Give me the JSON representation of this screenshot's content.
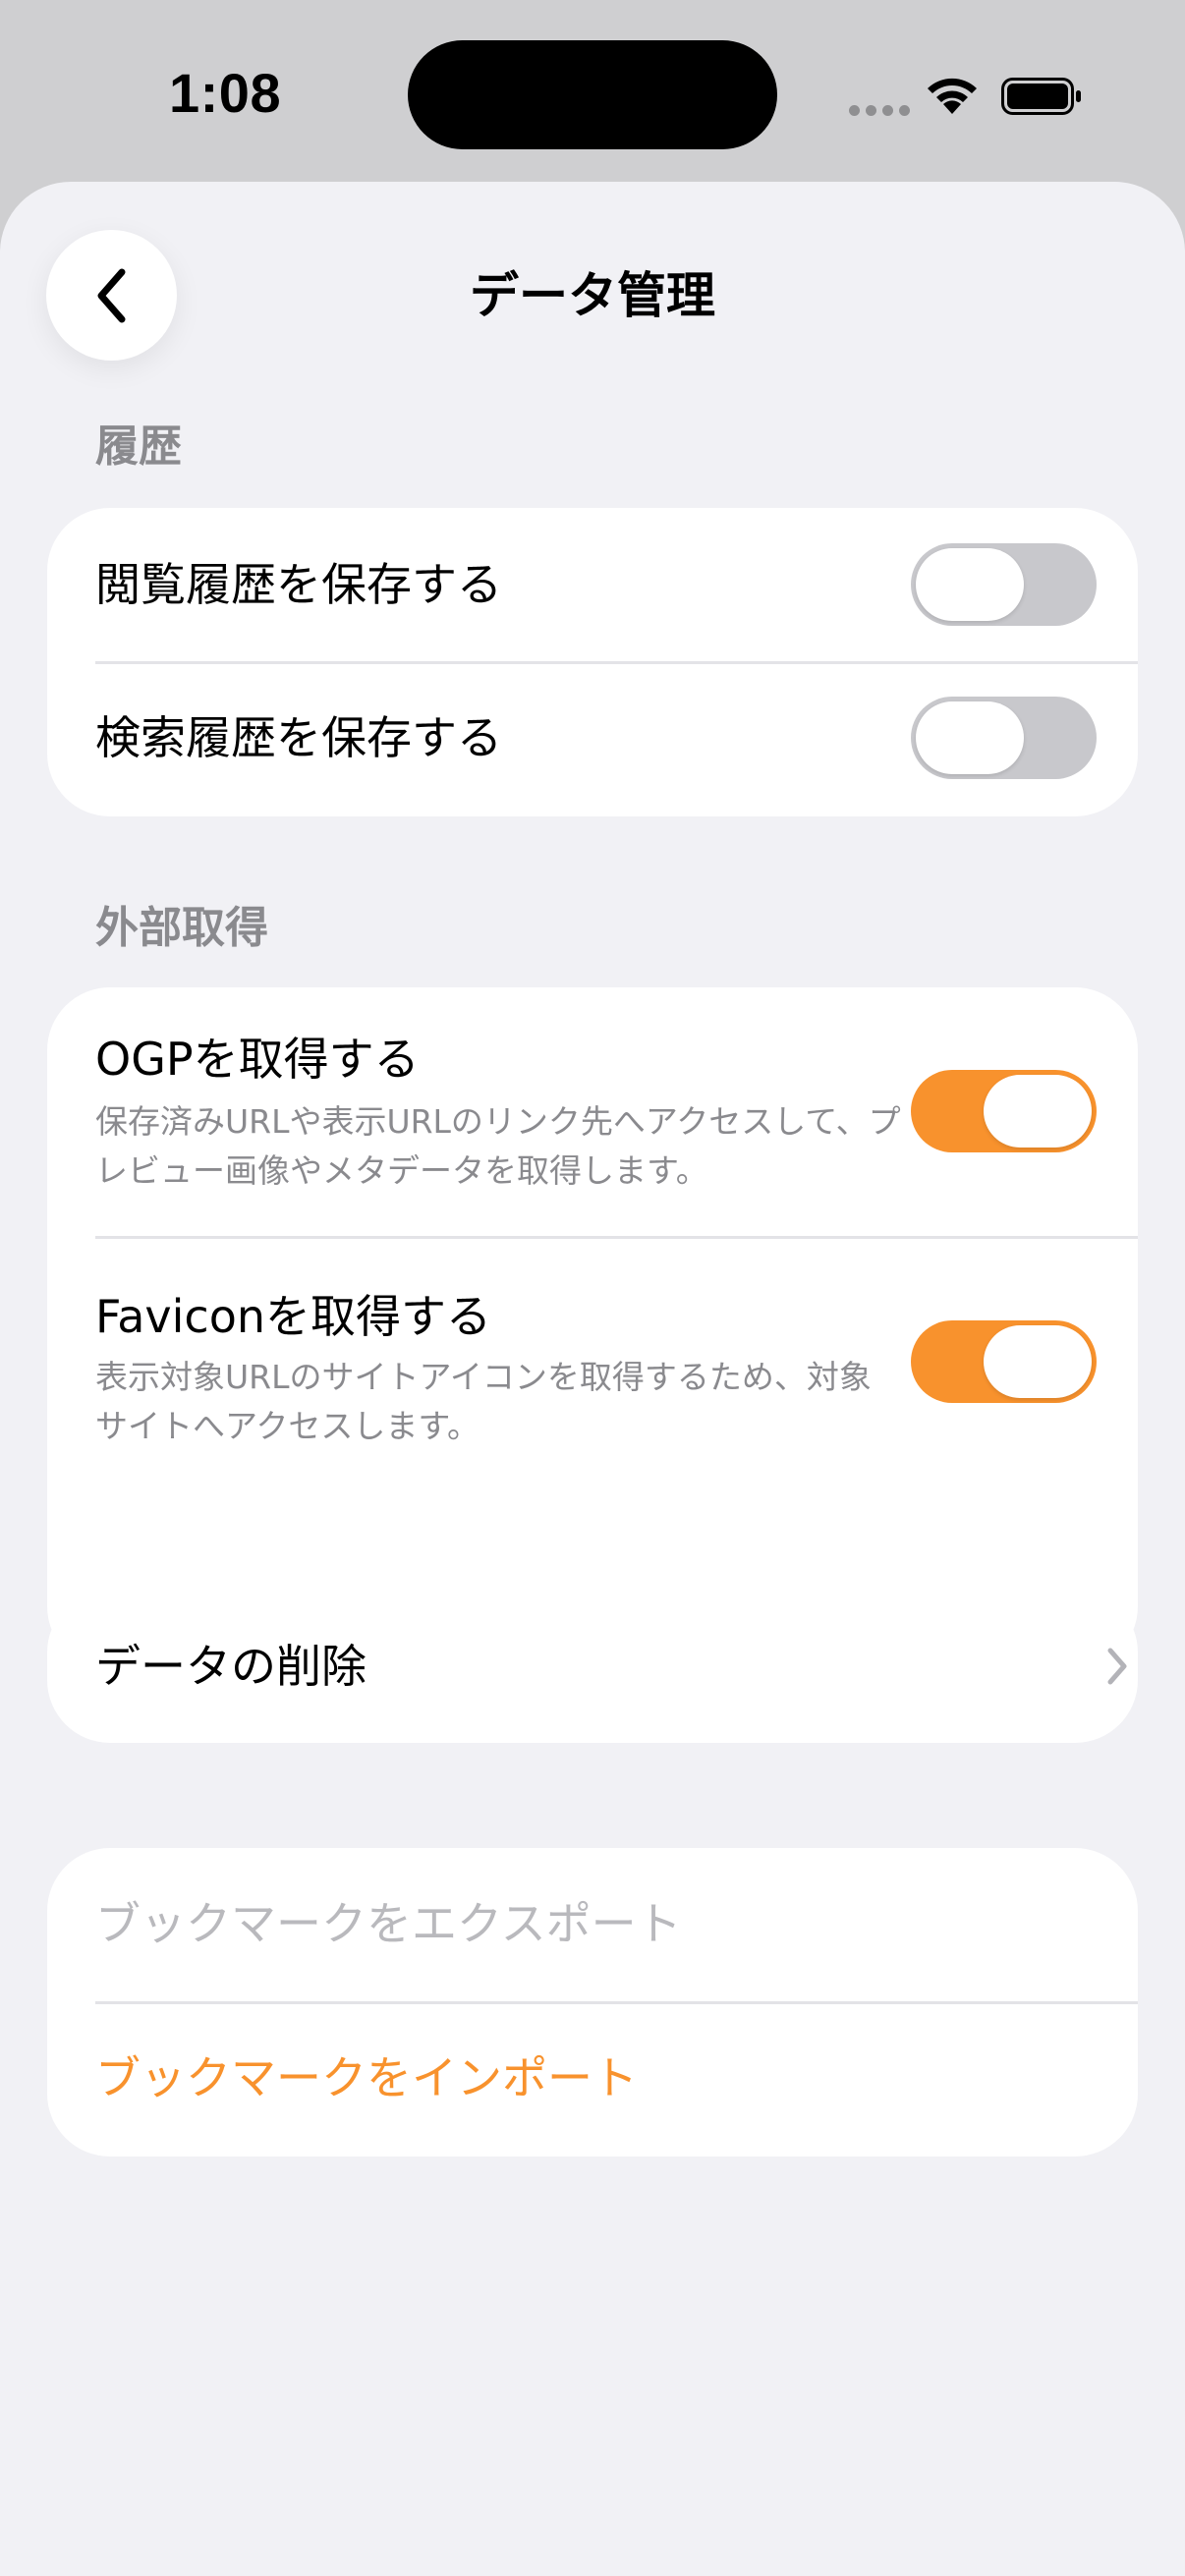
{
  "status_bar": {
    "time": "1:08"
  },
  "header": {
    "title": "データ管理",
    "back_icon": "chevron-left-icon"
  },
  "sections": {
    "history": {
      "header": "履歴",
      "items": [
        {
          "label": "閲覧履歴を保存する",
          "toggle": "off"
        },
        {
          "label": "検索履歴を保存する",
          "toggle": "off"
        }
      ]
    },
    "external": {
      "header": "外部取得",
      "items": [
        {
          "label": "OGPを取得する",
          "description": "保存済みURLや表示URLのリンク先へアクセスして、プレビュー画像やメタデータを取得します。",
          "toggle": "on"
        },
        {
          "label": "Faviconを取得する",
          "description": "表示対象URLのサイトアイコンを取得するため、対象サイトへアクセスします。",
          "toggle": "on"
        }
      ]
    },
    "data": {
      "delete_label": "データの削除"
    },
    "bookmarks": {
      "export_label": "ブックマークをエクスポート",
      "import_label": "ブックマークをインポート"
    }
  },
  "colors": {
    "accent": "#f8922d",
    "toggle_off": "#c8c8cc",
    "background": "#f1f1f5",
    "secondary_text": "#8a8a8e",
    "disabled_text": "#b9b9bd"
  }
}
